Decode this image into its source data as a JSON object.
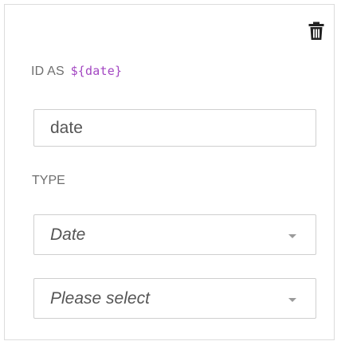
{
  "id_label": "ID AS",
  "id_variable": "${date}",
  "id_input": {
    "value": "date"
  },
  "type_label": "TYPE",
  "type_select": {
    "selected": "Date"
  },
  "format_select": {
    "selected": "Please select"
  },
  "icons": {
    "delete": "trash-icon",
    "caret": "chevron-down-icon"
  },
  "colors": {
    "variable": "#a347c2",
    "border": "#cfcfcf",
    "label": "#6f6f6f"
  }
}
